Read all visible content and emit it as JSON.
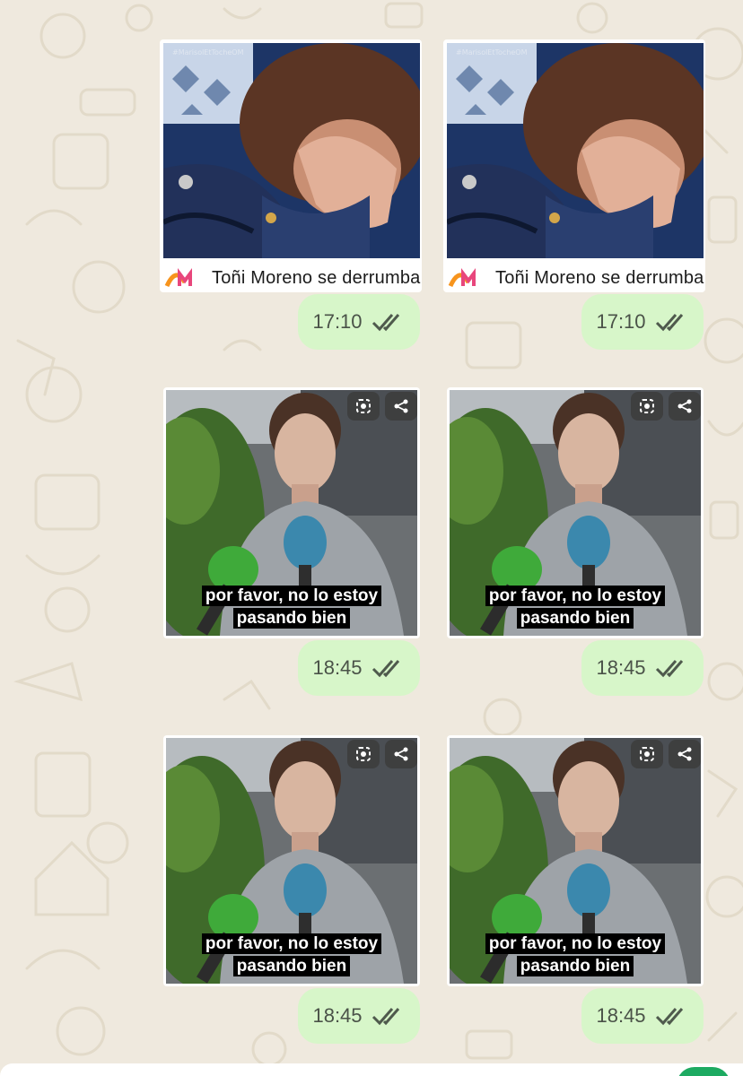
{
  "chat": {
    "columns": [
      {
        "link_preview": {
          "title": "Toñi Moreno se derrumba",
          "image_watermark": "#MarisolEtTocheOM"
        },
        "time1": "17:10",
        "videos": [
          {
            "line1": "por favor, no lo estoy",
            "line2": "pasando bien",
            "time": "18:45"
          },
          {
            "line1": "por favor, no lo estoy",
            "line2": "pasando bien",
            "time": "18:45"
          }
        ]
      },
      {
        "link_preview": {
          "title": "Toñi Moreno se derrumba",
          "image_watermark": "#MarisolEtTocheOM"
        },
        "time1": "17:10",
        "videos": [
          {
            "line1": "por favor, no lo estoy",
            "line2": "pasando bien",
            "time": "18:45"
          },
          {
            "line1": "por favor, no lo estoy",
            "line2": "pasando bien",
            "time": "18:45"
          }
        ]
      }
    ]
  },
  "icons": {
    "status": "double-check-read-icon",
    "overlay": [
      "lens-icon",
      "share-icon"
    ],
    "source_logo": "logo-icon"
  },
  "colors": {
    "background": "#efe9de",
    "outgoing_bubble": "#d7f6c9",
    "read_ticks": "#4f5a4d",
    "accent_green": "#1daa61"
  }
}
